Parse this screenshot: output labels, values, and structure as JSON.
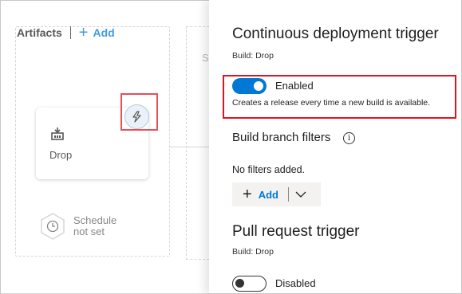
{
  "artifacts": {
    "title": "Artifacts",
    "add_label": "Add",
    "card": {
      "label": "Drop",
      "icon": "build-artifact-icon"
    },
    "trigger_icon": "lightning-icon",
    "schedule": {
      "line1": "Schedule",
      "line2": "not set",
      "icon": "clock-icon"
    }
  },
  "stage": {
    "label_fragment": "S"
  },
  "panel": {
    "title": "Continuous deployment trigger",
    "subtitle": "Build: Drop",
    "cd_toggle": {
      "state": "on",
      "label": "Enabled",
      "description": "Creates a release every time a new build is available."
    },
    "branch_filters": {
      "title": "Build branch filters",
      "info_icon": "info-icon",
      "empty_text": "No filters added.",
      "add_label": "Add"
    },
    "pr_trigger": {
      "title": "Pull request trigger",
      "subtitle": "Build: Drop",
      "toggle": {
        "state": "off",
        "label": "Disabled"
      }
    }
  },
  "colors": {
    "accent": "#0078d4",
    "highlight": "#e0141e"
  }
}
